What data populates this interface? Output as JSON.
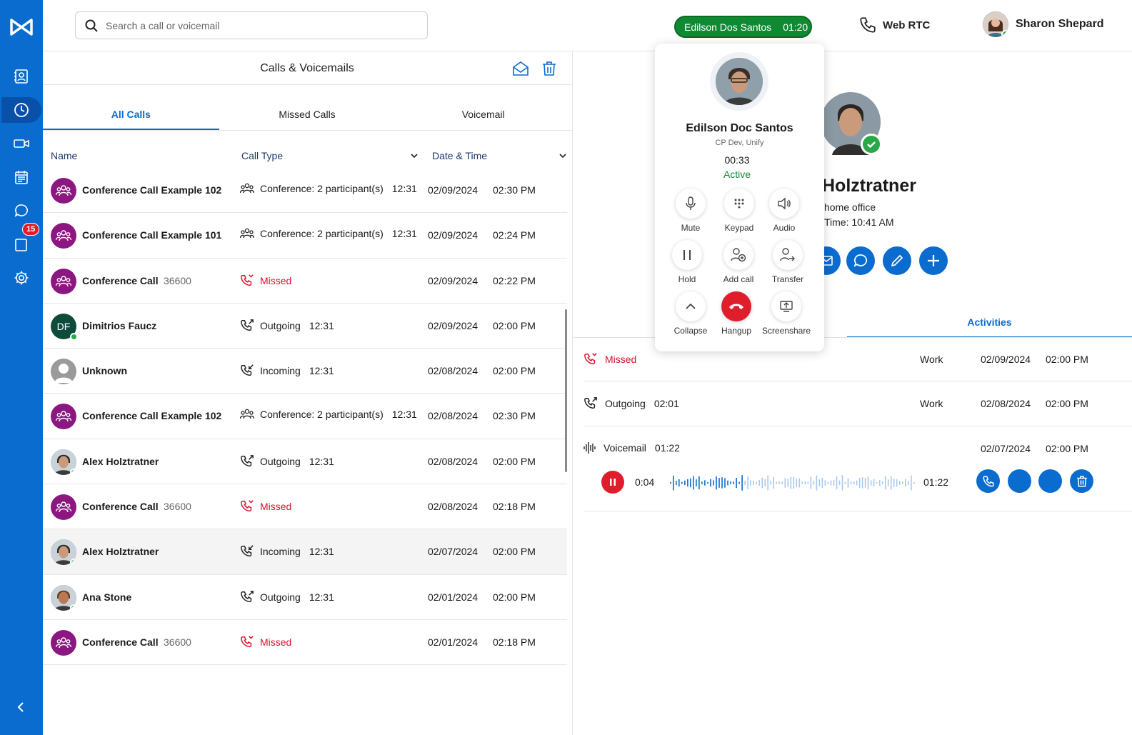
{
  "search": {
    "placeholder": "Search a call or voicemail"
  },
  "active_call": {
    "name": "Edilson Dos Santos",
    "timer": "01:20"
  },
  "webrtc": {
    "label": "Web RTC"
  },
  "user": {
    "name": "Sharon Shepard"
  },
  "nav": {
    "badge_count": "15"
  },
  "panel": {
    "title": "Calls & Voicemails",
    "tabs": [
      "All Calls",
      "Missed Calls",
      "Voicemail"
    ],
    "columns": {
      "name": "Name",
      "call_type": "Call Type",
      "date_time": "Date & Time"
    }
  },
  "calls": [
    {
      "name": "Conference Call Example 102",
      "ext": "",
      "avatar": "conference",
      "type": "Conference: 2 participant(s)",
      "duration": "12:31",
      "date": "02/09/2024",
      "time": "02:30 PM"
    },
    {
      "name": "Conference Call Example 101",
      "ext": "",
      "avatar": "conference",
      "type": "Conference: 2 participant(s)",
      "duration": "12:31",
      "date": "02/09/2024",
      "time": "02:24 PM"
    },
    {
      "name": "Conference Call",
      "ext": "36600",
      "avatar": "conference",
      "type": "Missed",
      "duration": "",
      "date": "02/09/2024",
      "time": "02:22 PM"
    },
    {
      "name": "Dimitrios Faucz",
      "ext": "",
      "avatar": "DF",
      "type": "Outgoing",
      "duration": "12:31",
      "date": "02/09/2024",
      "time": "02:00 PM"
    },
    {
      "name": "Unknown",
      "ext": "",
      "avatar": "unknown",
      "type": "Incoming",
      "duration": "12:31",
      "date": "02/08/2024",
      "time": "02:00 PM"
    },
    {
      "name": "Conference Call Example 102",
      "ext": "",
      "avatar": "conference",
      "type": "Conference: 2 participant(s)",
      "duration": "12:31",
      "date": "02/08/2024",
      "time": "02:30 PM"
    },
    {
      "name": "Alex Holztratner",
      "ext": "",
      "avatar": "photo",
      "type": "Outgoing",
      "duration": "12:31",
      "date": "02/08/2024",
      "time": "02:00 PM"
    },
    {
      "name": "Conference Call",
      "ext": "36600",
      "avatar": "conference",
      "type": "Missed",
      "duration": "",
      "date": "02/08/2024",
      "time": "02:18 PM"
    },
    {
      "name": "Alex Holztratner",
      "ext": "",
      "avatar": "photo",
      "type": "Incoming",
      "duration": "12:31",
      "date": "02/07/2024",
      "time": "02:00 PM"
    },
    {
      "name": "Ana Stone",
      "ext": "",
      "avatar": "photo",
      "type": "Outgoing",
      "duration": "12:31",
      "date": "02/01/2024",
      "time": "02:00 PM"
    },
    {
      "name": "Conference Call",
      "ext": "36600",
      "avatar": "conference",
      "type": "Missed",
      "duration": "",
      "date": "02/01/2024",
      "time": "02:18 PM"
    }
  ],
  "contact": {
    "name": "Holztratner",
    "line1": "home office",
    "line2": "Time: 10:41 AM",
    "tab": "Activities"
  },
  "activities": [
    {
      "type": "Missed",
      "duration": "",
      "category": "Work",
      "date": "02/09/2024",
      "time": "02:00 PM"
    },
    {
      "type": "Outgoing",
      "duration": "02:01",
      "category": "Work",
      "date": "02/08/2024",
      "time": "02:00 PM"
    },
    {
      "type": "Voicemail",
      "duration": "01:22",
      "category": "",
      "date": "02/07/2024",
      "time": "02:00 PM"
    }
  ],
  "voicemail_player": {
    "current": "0:04",
    "total": "01:22",
    "progress": 0.05
  },
  "popup": {
    "name": "Edilson Doc Santos",
    "org": "CP Dev, Unify",
    "elapsed": "00:33",
    "status": "Active",
    "buttons": [
      "Mute",
      "Keypad",
      "Audio",
      "Hold",
      "Add call",
      "Transfer",
      "Collapse",
      "Hangup",
      "Screenshare"
    ]
  },
  "colors": {
    "brand": "#0a6ccf",
    "missed": "#d9122e",
    "active": "#108a32",
    "conference": "#8c1780"
  }
}
